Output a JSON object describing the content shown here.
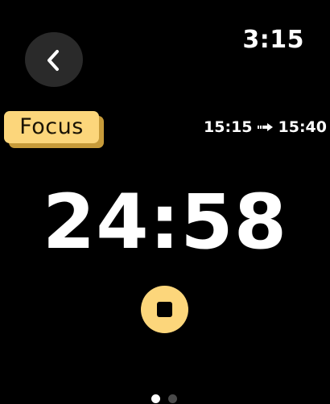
{
  "header": {
    "time": "3:15",
    "back_icon": "chevron-left-icon"
  },
  "session": {
    "mode_label": "Focus",
    "start_time": "15:15",
    "end_time": "15:40",
    "range_icon": "arrow-right-icon"
  },
  "timer": {
    "remaining": "24:58"
  },
  "controls": {
    "stop_icon": "stop-icon"
  },
  "pagination": {
    "page_count": 2,
    "active_page": 1
  },
  "colors": {
    "accent": "#fcd67b",
    "accent_shadow": "#c79b3a",
    "background": "#000000",
    "button_bg": "#2a2a2a"
  }
}
